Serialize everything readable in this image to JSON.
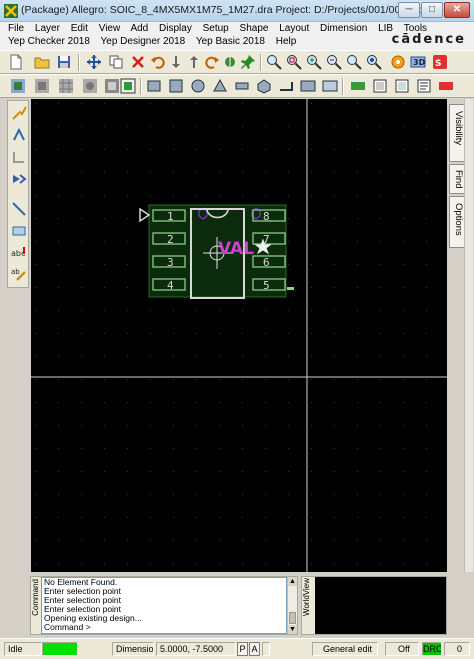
{
  "window": {
    "title": "(Package) Allegro: SOIC_8_4MX5MX1M75_1M27.dra  Project: D:/Projects/001/001b0p/pcb",
    "minimize": "─",
    "maximize": "□",
    "close": "✕"
  },
  "menubar": {
    "row1": [
      "File",
      "Layer",
      "Edit",
      "View",
      "Add",
      "Display",
      "Setup",
      "Shape",
      "Layout",
      "Dimension",
      "LIB",
      "Tools"
    ],
    "row2": [
      "Yep Checker 2018",
      "Yep Designer 2018",
      "Yep Basic 2018",
      "Help"
    ],
    "brand": "cādence"
  },
  "canvas": {
    "background": "#000000",
    "footprint": {
      "pins_left": [
        "1",
        "2",
        "3",
        "4"
      ],
      "pins_right": [
        "8",
        "7",
        "6",
        "5"
      ],
      "refdes": "VAL",
      "pad_color": "#7fc27f",
      "silk_color": "#d8d8d8",
      "refdes_color": "#d040d0",
      "placebound_color": "#8a2be2"
    }
  },
  "sidetabs": {
    "visibility": "Visibility",
    "find": "Find",
    "options": "Options"
  },
  "console": {
    "label": "Command",
    "lines": [
      "No Element Found.",
      "Enter selection point",
      "Enter selection point",
      "Enter selection point",
      "Opening existing design...",
      "Command >"
    ]
  },
  "worldview": {
    "label": "WorldView"
  },
  "statusbar": {
    "state": "Idle",
    "class": "Dimensio",
    "coords": "5.0000, -7.5000",
    "p_button": "P",
    "a_button": "A",
    "mode": "General edit",
    "drc_state": "Off",
    "drc": "DRC",
    "count": "0"
  },
  "colors": {
    "accent_green": "#00e000",
    "title_gradient": "#b9d3ec",
    "close_red": "#c9493a"
  }
}
